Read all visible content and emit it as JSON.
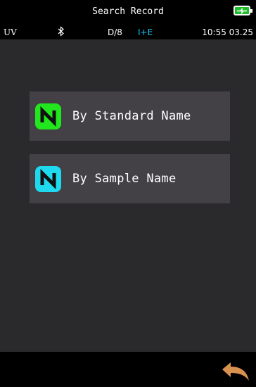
{
  "header": {
    "title": "Search Record",
    "battery_icon": "battery-charging-icon"
  },
  "status": {
    "uv": "UV",
    "bluetooth_icon": "bluetooth-icon",
    "geometry": "D/8",
    "mode": "I+E",
    "time": "10:55 03.25"
  },
  "menu": {
    "items": [
      {
        "label": "By Standard Name",
        "icon": "standard-name-icon",
        "color": "#22e61e"
      },
      {
        "label": "By Sample Name",
        "icon": "sample-name-icon",
        "color": "#1fd9ee"
      }
    ]
  },
  "footer": {
    "back_icon": "back-arrow-icon"
  },
  "colors": {
    "background": "#2a2a2c",
    "bars": "#000000",
    "card": "#434146",
    "accent_mode": "#19c2e8",
    "back_arrow": "#d9914f"
  }
}
